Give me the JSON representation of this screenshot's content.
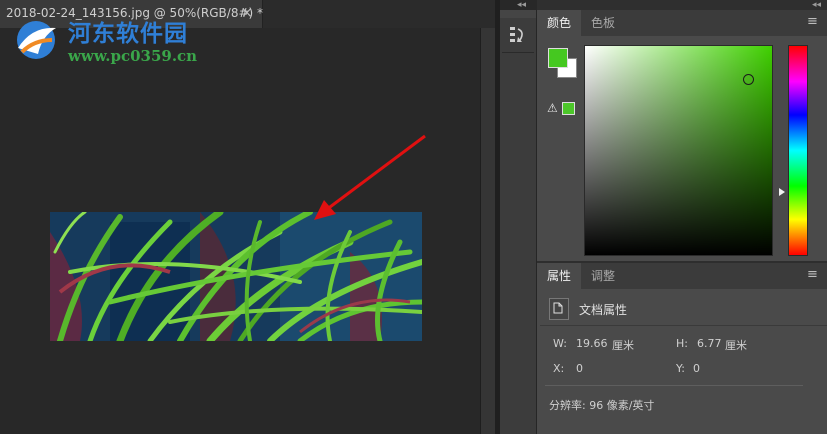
{
  "document": {
    "tab_title": "2018-02-24_143156.jpg @ 50%(RGB/8#) *",
    "close_label": "×"
  },
  "watermark": {
    "title": "河东软件园",
    "url": "www.pc0359.cn"
  },
  "panel_controls": {
    "collapse_left": "◂◂",
    "collapse_right": "◂◂",
    "menu_icon": "≡"
  },
  "color_panel": {
    "tabs": [
      "颜色",
      "色板"
    ],
    "active_tab": 0,
    "foreground_color": "#45c820",
    "background_color": "#ffffff",
    "hue_color": "#3fd000",
    "warning_icon": "⚠"
  },
  "properties_panel": {
    "tabs": [
      "属性",
      "调整"
    ],
    "active_tab": 0,
    "section_title": "文档属性",
    "width_label": "W:",
    "width_value": "19.66",
    "width_unit": "厘米",
    "height_label": "H:",
    "height_value": "6.77",
    "height_unit": "厘米",
    "x_label": "X:",
    "x_value": "0",
    "y_label": "Y:",
    "y_value": "0",
    "resolution": "分辨率: 96 像素/英寸"
  },
  "colors": {
    "annotation_arrow": "#e01010",
    "watermark_blue": "#2f7fd6",
    "watermark_green": "#3aa64a"
  }
}
